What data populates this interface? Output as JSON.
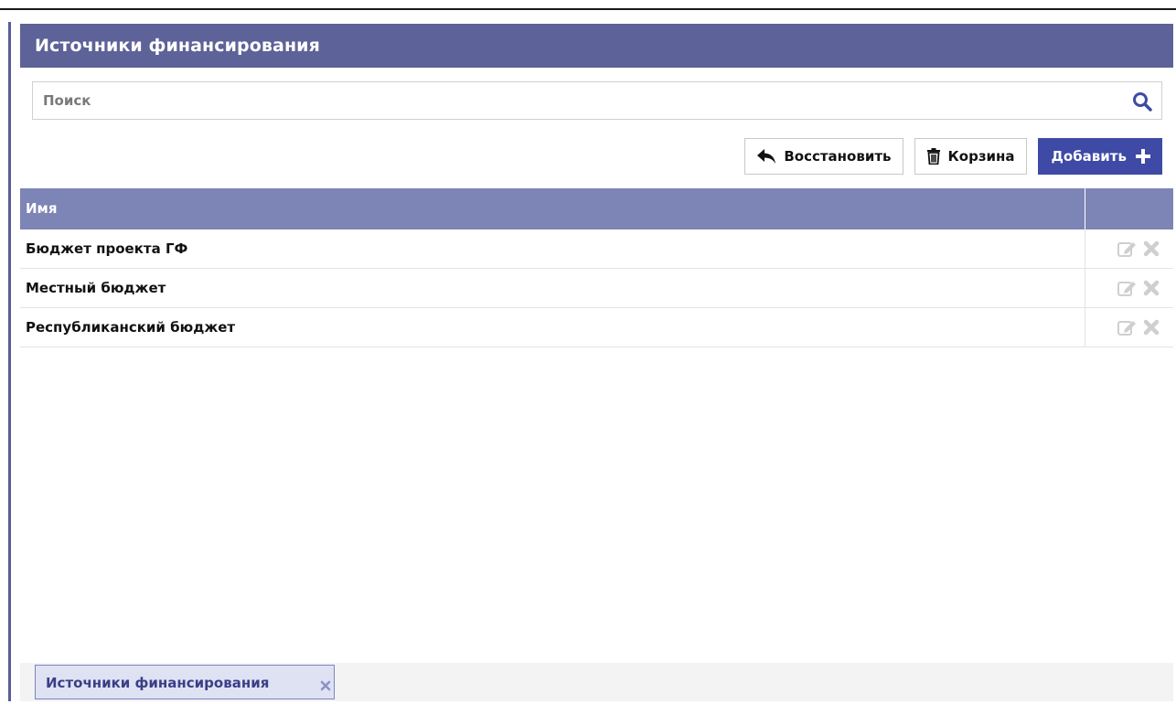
{
  "panel": {
    "title": "Источники финансирования"
  },
  "search": {
    "placeholder": "Поиск",
    "value": "",
    "icon": "search-icon"
  },
  "toolbar": {
    "restore_label": "Восстановить",
    "trash_label": "Корзина",
    "add_label": "Добавить"
  },
  "table": {
    "columns": [
      "Имя",
      ""
    ],
    "rows": [
      {
        "name": "Бюджет проекта ГФ"
      },
      {
        "name": "Местный бюджет"
      },
      {
        "name": "Республиканский бюджет"
      }
    ]
  },
  "bottom_tabs": [
    {
      "label": "Источники финансирования"
    }
  ],
  "colors": {
    "header": "#5d6298",
    "table_header": "#7d84b6",
    "primary_button": "#3e4aa6",
    "tab_bg": "#dfe2f3"
  }
}
